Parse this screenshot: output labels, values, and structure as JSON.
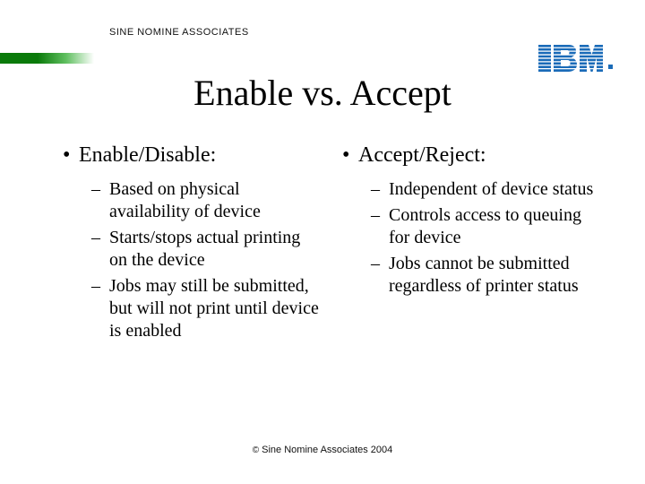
{
  "header": {
    "brand": "SINE NOMINE ASSOCIATES",
    "logo_name": "ibm-logo"
  },
  "title": "Enable vs. Accept",
  "columns": {
    "left": {
      "heading": "Enable/Disable:",
      "items": [
        "Based on physical availability of device",
        "Starts/stops actual printing on the device",
        "Jobs may still be submitted, but will not print until device is enabled"
      ]
    },
    "right": {
      "heading": "Accept/Reject:",
      "items": [
        "Independent of device status",
        "Controls access to queuing for device",
        "Jobs cannot be submitted regardless of printer status"
      ]
    }
  },
  "footer": "Sine Nomine Associates 2004"
}
